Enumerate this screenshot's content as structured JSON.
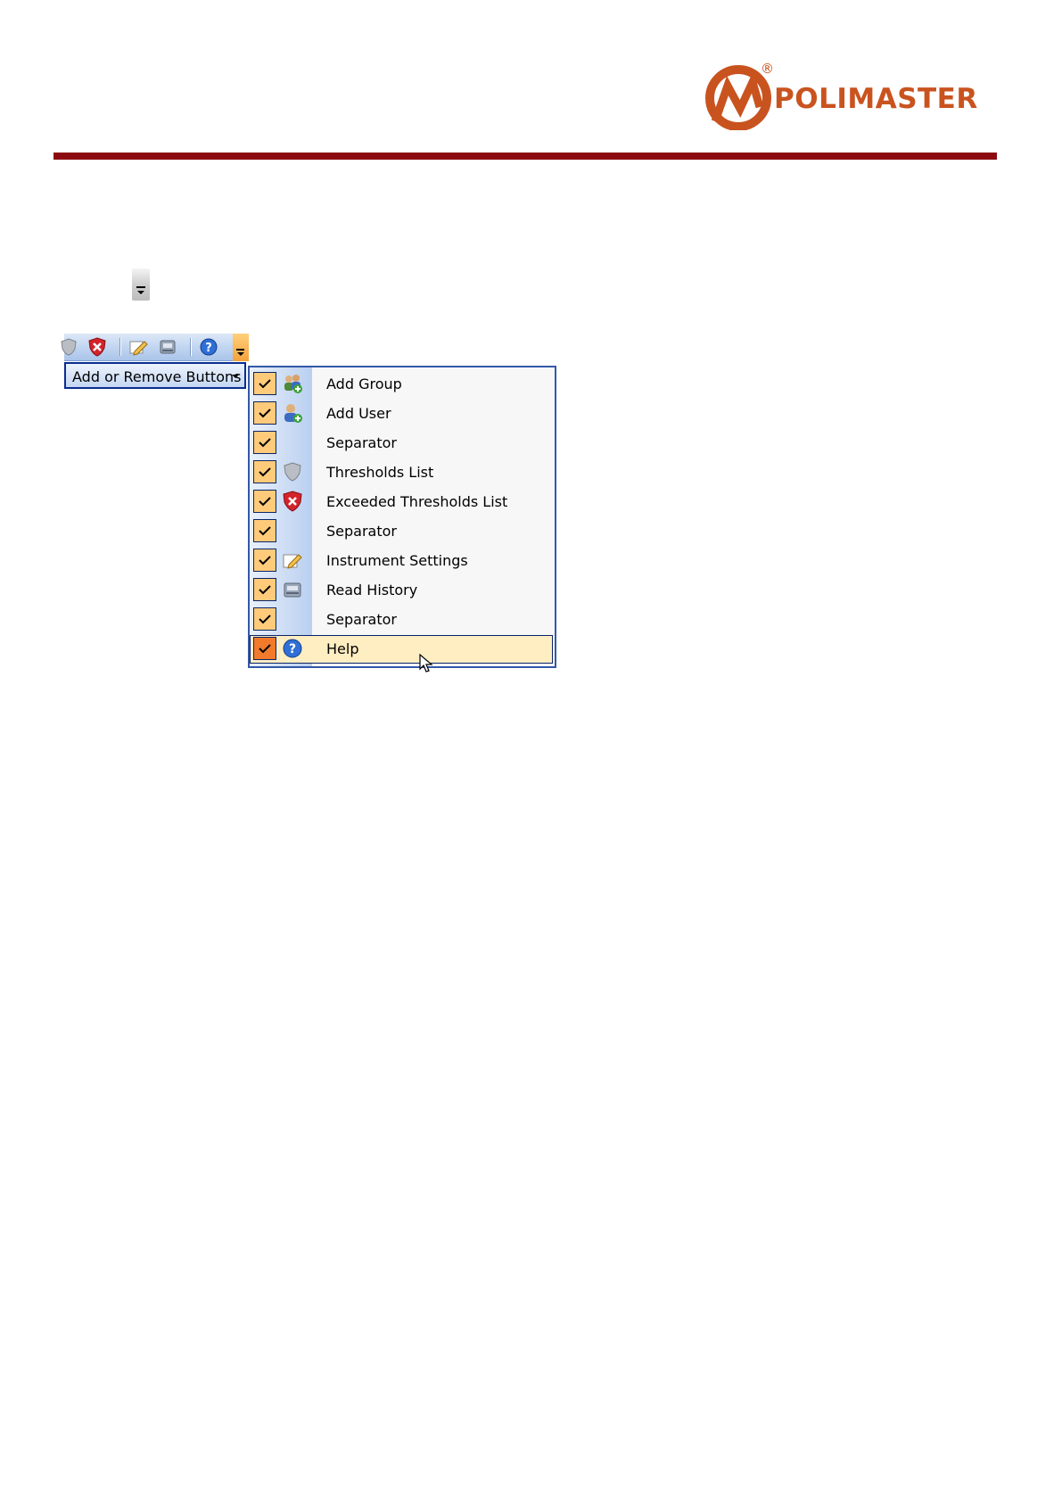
{
  "header": {
    "logo_text": "POLIMASTER",
    "registered_mark": "®",
    "brand_color": "#c9531f",
    "rule_color": "#8b0a10"
  },
  "toolbar": {
    "icons": [
      "shield-icon",
      "exceeded-shield-icon",
      "instrument-settings-icon",
      "read-history-icon",
      "help-icon"
    ],
    "add_remove_label": "Add or Remove Buttons"
  },
  "menu": {
    "items": [
      {
        "label": "Add Group",
        "icon": "add-group-icon",
        "checked": true
      },
      {
        "label": "Add User",
        "icon": "add-user-icon",
        "checked": true
      },
      {
        "label": "Separator",
        "icon": "",
        "checked": true
      },
      {
        "label": "Thresholds List",
        "icon": "shield-icon",
        "checked": true
      },
      {
        "label": "Exceeded Thresholds List",
        "icon": "exceeded-shield-icon",
        "checked": true
      },
      {
        "label": "Separator",
        "icon": "",
        "checked": true
      },
      {
        "label": "Instrument Settings",
        "icon": "instrument-settings-icon",
        "checked": true
      },
      {
        "label": "Read History",
        "icon": "read-history-icon",
        "checked": true
      },
      {
        "label": "Separator",
        "icon": "",
        "checked": true
      },
      {
        "label": "Help",
        "icon": "help-icon",
        "checked": true,
        "highlighted": true
      }
    ]
  }
}
